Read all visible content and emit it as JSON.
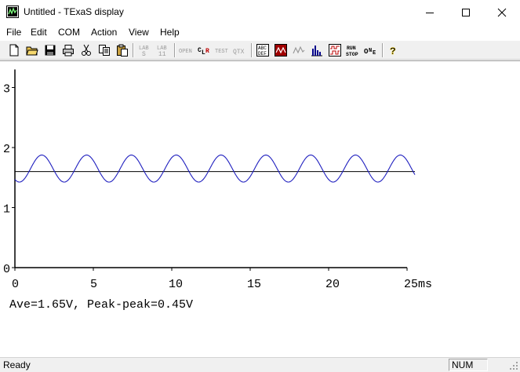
{
  "window": {
    "title": "Untitled - TExaS display"
  },
  "menu": [
    "File",
    "Edit",
    "COM",
    "Action",
    "View",
    "Help"
  ],
  "toolbar": {
    "items": [
      "new-file-icon",
      "open-folder-icon",
      "save-icon",
      "print-icon",
      "cut-icon",
      "copy-icon",
      "paste-icon",
      "lab-s-icon",
      "lab-11-icon",
      "open-icon",
      "clear-icon",
      "test-icon",
      "qtx-icon",
      "abc-def-icon",
      "bmp-icon",
      "scope-icon",
      "histogram-icon",
      "logic-analyzer-icon",
      "run-stop-icon",
      "one-icon",
      "help-icon"
    ]
  },
  "chart_data": {
    "type": "line",
    "title": "",
    "xlabel": "",
    "ylabel": "",
    "x_unit": "ms",
    "xlim": [
      0,
      25
    ],
    "ylim": [
      0,
      3.3
    ],
    "x_ticks": [
      0,
      5,
      10,
      15,
      20,
      25
    ],
    "x_tick_labels": [
      "0",
      "5",
      "10",
      "15",
      "20",
      "25ms"
    ],
    "y_ticks": [
      0,
      1,
      2,
      3
    ],
    "y_tick_labels": [
      "0",
      "1",
      "2",
      "3"
    ],
    "series": [
      {
        "name": "",
        "kind": "sine",
        "offset": 1.65,
        "amplitude": 0.225,
        "period_ms": 2.857,
        "x_start": 0,
        "x_end": 25.5,
        "color": "#1f1fbf"
      }
    ],
    "reference_line": {
      "y": 1.6,
      "x_start": 0,
      "x_end": 25.5,
      "color": "#000000"
    },
    "annotation": "Ave=1.65V, Peak-peak=0.45V"
  },
  "status": {
    "text": "Ready",
    "num": "NUM"
  }
}
